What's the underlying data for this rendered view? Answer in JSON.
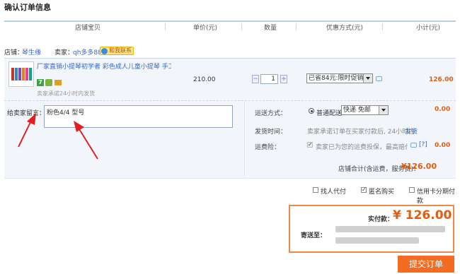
{
  "page": {
    "title": "确认订单信息"
  },
  "columns": [
    "店铺宝贝",
    "单价(元)",
    "数量",
    "优惠方式(元)",
    "小计(元)"
  ],
  "shop": {
    "shop_label": "店铺：",
    "shop_name": "琴生缘",
    "seller_label": "卖家：",
    "seller_name": "qh多多88",
    "contact_label": "和我联系"
  },
  "item": {
    "title": "厂家直销小提琴初学者 彩色成人儿童小提琴 手工...",
    "badge_7": "7",
    "ship_promise": "卖家承诺24小时内发货",
    "unit_price": "210.00",
    "quantity": "1",
    "qty_minus": "−",
    "qty_plus": "+",
    "discount": "已省84元:限时促销",
    "subtotal": "126.00"
  },
  "note": {
    "label": "给卖家留言：",
    "value": "粉色4/4 型号"
  },
  "delivery": {
    "method_label": "运送方式：",
    "method_option": "普通配送",
    "method_select": "快递 免邮",
    "method_fee": "0.00",
    "time_label": "发货时间：",
    "time_text": "卖家承诺订单在买家付款后, 24小时内",
    "time_link": "发货",
    "insurance_label": "运费险：",
    "insurance_text": "卖家已为您的运费投保，最高赔付...",
    "insurance_help": "[?]",
    "insurance_fee": "0.00",
    "shop_total_label": "店铺合计(含运费，服务费)：",
    "shop_total": "¥126.00"
  },
  "options": {
    "proxy_pay": "找人代付",
    "anonymous": "匿名购买",
    "installment": "信用卡分期付款"
  },
  "payment": {
    "label": "实付款：",
    "amount": "¥ 126.00",
    "ship_to_label": "寄送至："
  },
  "submit_label": "提交订单",
  "colors": {
    "accent": "#f36c21",
    "price": "#e45b0f",
    "link": "#3366cc"
  }
}
